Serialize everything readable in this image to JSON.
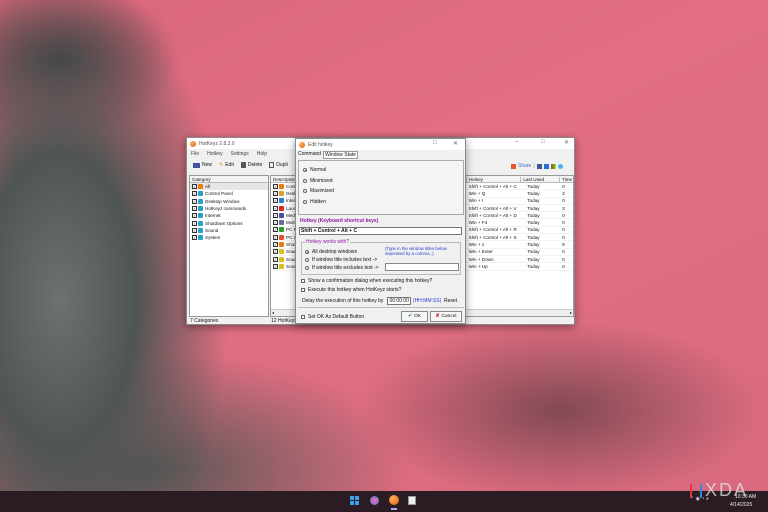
{
  "main": {
    "title": "HotKeyz 2.8.3.0",
    "menu": [
      "File",
      "Hotkey",
      "Settings",
      "Help"
    ],
    "toolbar": {
      "new": "New",
      "edit": "Edit",
      "delete": "Delete",
      "duplicate": "Dupli",
      "share": "Share"
    },
    "category_header": "Category",
    "categories": [
      "All",
      "Control Panel",
      "Desktop Window",
      "HotKeyz commands",
      "Internet",
      "Shutdown Options",
      "Sound",
      "System"
    ],
    "columns": {
      "description": "Description",
      "hotkey": "Hotkey",
      "last_used": "Last Used",
      "times": "Time"
    },
    "rows": [
      {
        "desc": "Cont",
        "hotkey": "Shift + Control + Alt + C",
        "last": "Today",
        "times": "0"
      },
      {
        "desc": "Desk",
        "hotkey": "Win + Q",
        "last": "Today",
        "times": "3"
      },
      {
        "desc": "Inter",
        "hotkey": "Win + I",
        "last": "Today",
        "times": "0"
      },
      {
        "desc": "Laun",
        "hotkey": "Shift + Control + Alt + V",
        "last": "Today",
        "times": "3"
      },
      {
        "desc": "Medi",
        "hotkey": "Shift + Control + Alt + D",
        "last": "Today",
        "times": "0"
      },
      {
        "desc": "Multi",
        "hotkey": "Win + F4",
        "last": "Today",
        "times": "0"
      },
      {
        "desc": "PC P",
        "hotkey": "Shift + Control + Alt + R",
        "last": "Today",
        "times": "0"
      },
      {
        "desc": "PC S",
        "hotkey": "Shift + Control + Alt + S",
        "last": "Today",
        "times": "0"
      },
      {
        "desc": "Show",
        "hotkey": "Win + 1",
        "last": "Today",
        "times": "9"
      },
      {
        "desc": "Soun",
        "hotkey": "Win + Enter",
        "last": "Today",
        "times": "0"
      },
      {
        "desc": "Soun",
        "hotkey": "Win + Down",
        "last": "Today",
        "times": "0"
      },
      {
        "desc": "Soun",
        "hotkey": "Win + Up",
        "last": "Today",
        "times": "0"
      }
    ],
    "status_categories": "7 Categories",
    "status_hotkeys": "12 HotKeys"
  },
  "dialog": {
    "title": "Edit hotkey",
    "tabs": [
      "Command",
      "Window State"
    ],
    "states": [
      "Normal",
      "Minimized",
      "Maximized",
      "Hidden"
    ],
    "hotkey_label": "Hotkey (Keyboard shortcut keys)",
    "hotkey_value": "Shift + Control + Alt + C",
    "works_with_label": "Hotkey works with?",
    "works_with": [
      "All desktop windows",
      "If window title includes text ->",
      "If window title excludes text ->"
    ],
    "titles_hint": "(Type in the window titles below seperated by a comma ,)",
    "titles_value": "",
    "confirm": "Show a confirmation dialog when executing this hotkey?",
    "on_start": "Execute this hotkey when HotKeyz starts?",
    "delay_label": "Delay the execution of this hotkey by",
    "delay_value": "00:00:00",
    "delay_format": "(HH:MM:SS)",
    "reset": "Reset",
    "default_ok": "Set OK As Default Button",
    "ok": "OK",
    "cancel": "Cancel"
  },
  "taskbar": {
    "time": "10:30 AM",
    "date": "4/14/2025"
  },
  "watermark": "XDA",
  "colors": {
    "accent_purple": "#8b1a9e",
    "hint_blue": "#2a3bd6"
  }
}
